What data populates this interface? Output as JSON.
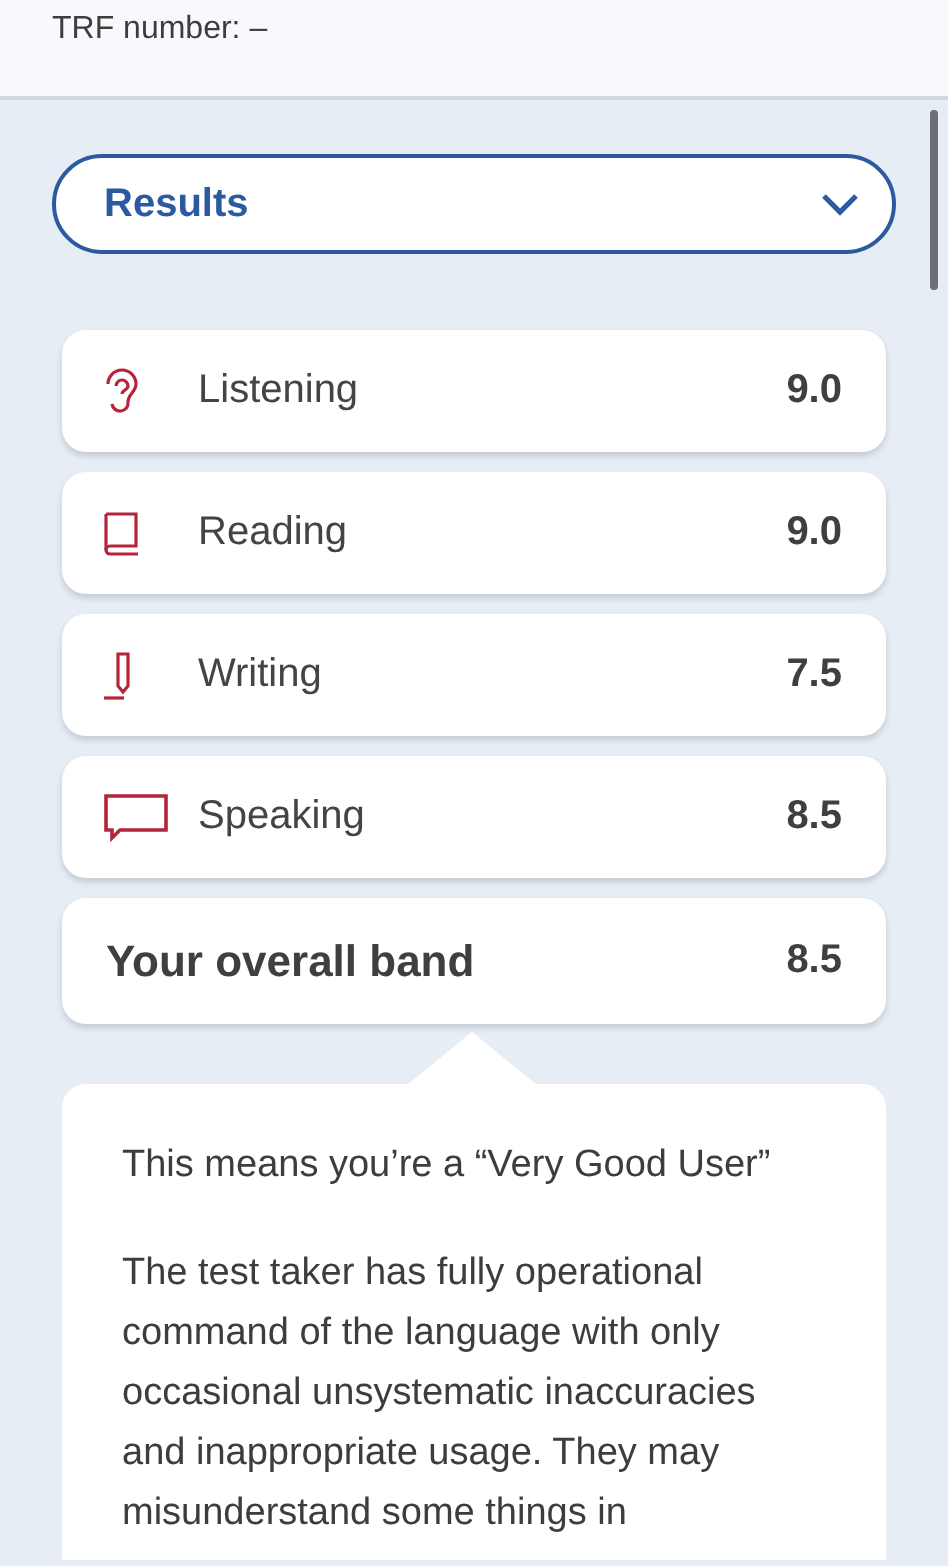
{
  "header": {
    "trf_label": "TRF number: –"
  },
  "dropdown": {
    "label": "Results",
    "expanded": false
  },
  "scores": [
    {
      "kind": "listening",
      "label": "Listening",
      "score": "9.0"
    },
    {
      "kind": "reading",
      "label": "Reading",
      "score": "9.0"
    },
    {
      "kind": "writing",
      "label": "Writing",
      "score": "7.5"
    },
    {
      "kind": "speaking",
      "label": "Speaking",
      "score": "8.5"
    }
  ],
  "overall": {
    "label": "Your overall band",
    "score": "8.5"
  },
  "description": {
    "title": "This means you’re a “Very Good User”",
    "body": "The test taker has fully operational command of the language with only occasional unsystematic inaccuracies and inappropriate usage. They may misunderstand some things in"
  }
}
